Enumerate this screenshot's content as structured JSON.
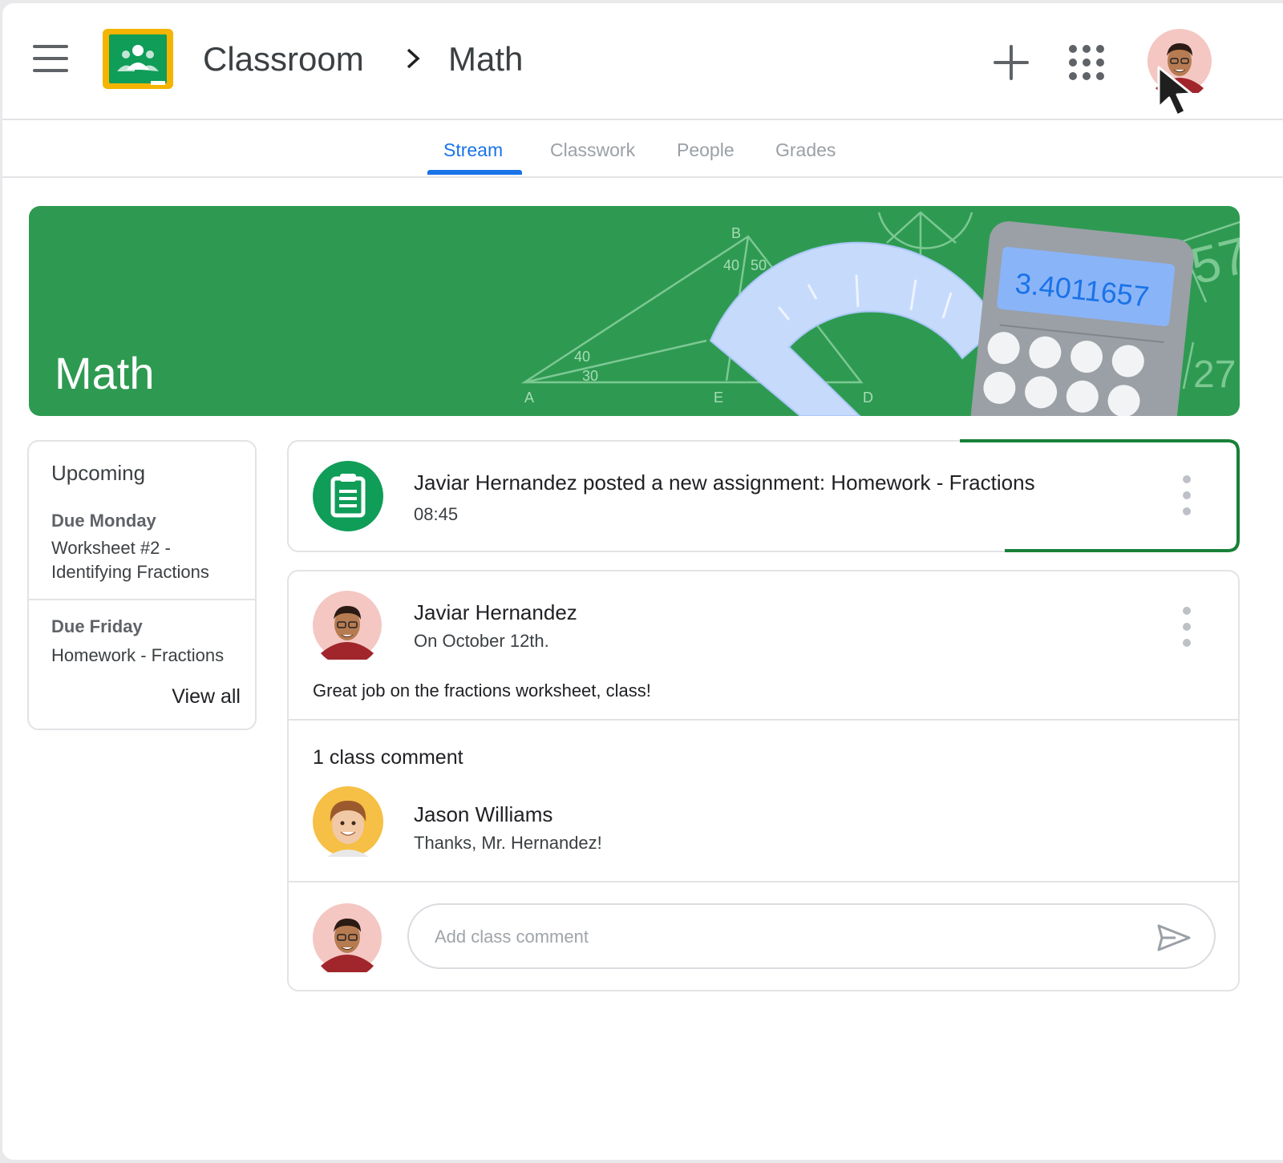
{
  "header": {
    "app_title": "Classroom",
    "course_title": "Math",
    "icons": [
      "menu-icon",
      "classroom-logo-icon",
      "chevron-right-icon",
      "plus-icon",
      "apps-grid-icon",
      "profile-avatar",
      "mouse-cursor-icon"
    ]
  },
  "tabs": [
    {
      "label": "Stream",
      "active": true
    },
    {
      "label": "Classwork",
      "active": false
    },
    {
      "label": "People",
      "active": false
    },
    {
      "label": "Grades",
      "active": false
    }
  ],
  "banner": {
    "title": "Math",
    "art_labels": {
      "a": "A",
      "b": "B",
      "d": "D",
      "e": "E",
      "angle_40_top": "40",
      "angle_50": "50",
      "angle_40_left": "40",
      "angle_30": "30",
      "calc_display": "3.4011657",
      "num_57": "57",
      "num_27": "27"
    }
  },
  "upcoming": {
    "title": "Upcoming",
    "items": [
      {
        "due": "Due Monday",
        "name": "Worksheet #2 - Identifying Fractions"
      },
      {
        "due": "Due Friday",
        "name": "Homework - Fractions"
      }
    ],
    "view_all": "View all"
  },
  "assignment_post": {
    "text": "Javiar Hernandez posted a new assignment: Homework - Fractions",
    "time": "08:45"
  },
  "announcement": {
    "author": "Javiar Hernandez",
    "date": "On October 12th.",
    "body": "Great job on the fractions worksheet, class!",
    "comments_count": "1 class comment",
    "comments": [
      {
        "author": "Jason Williams",
        "text": "Thanks, Mr. Hernandez!"
      }
    ],
    "comment_placeholder": "Add class comment"
  },
  "colors": {
    "brand_green": "#0f9d58",
    "banner_green": "#2e9a51",
    "accent_blue": "#1a73e8",
    "logo_yellow": "#f4b400"
  }
}
